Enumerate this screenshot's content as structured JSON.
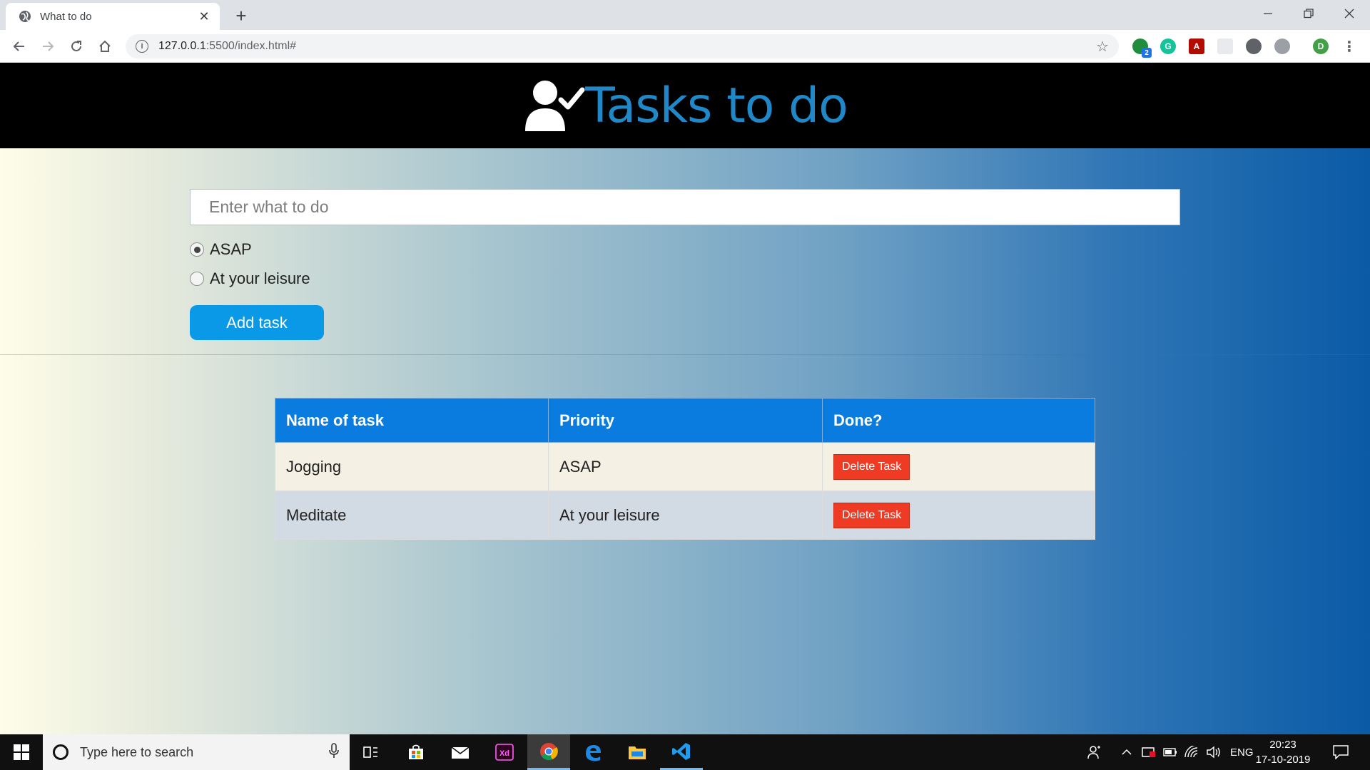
{
  "browser": {
    "tab_title": "What to do",
    "url_host": "127.0.0.1",
    "url_rest": ":5500/index.html#",
    "new_tab": "+",
    "extension_badge": "2",
    "profile_initial": "D"
  },
  "header": {
    "title": "Tasks to do"
  },
  "form": {
    "placeholder": "Enter what to do",
    "priority_options": [
      {
        "label": "ASAP",
        "checked": true
      },
      {
        "label": "At your leisure",
        "checked": false
      }
    ],
    "add_button": "Add task"
  },
  "table": {
    "headers": [
      "Name of task",
      "Priority",
      "Done?"
    ],
    "rows": [
      {
        "name": "Jogging",
        "priority": "ASAP",
        "action": "Delete Task"
      },
      {
        "name": "Meditate",
        "priority": "At your leisure",
        "action": "Delete Task"
      }
    ]
  },
  "taskbar": {
    "search_placeholder": "Type here to search",
    "language": "ENG",
    "time": "20:23",
    "date": "17-10-2019"
  },
  "colors": {
    "header_bg": "#000000",
    "title": "#1f88c9",
    "add_button": "#0a99e6",
    "table_header": "#0a7bdf",
    "delete_button": "#ef3b24"
  }
}
